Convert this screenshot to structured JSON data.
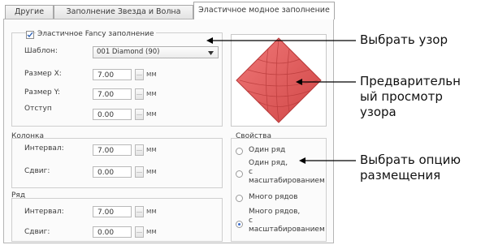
{
  "tabs": [
    "Другие",
    "Заполнение Звезда и Волна",
    "Эластичное модное заполнение"
  ],
  "fancy": {
    "checkbox_label": "Эластичное Fancy заполнение",
    "checked": true,
    "pattern_label": "Шаблон:",
    "pattern_value": "001 Diamond (90)",
    "size_x_label": "Размер X:",
    "size_x_value": "7.00",
    "size_y_label": "Размер Y:",
    "size_y_value": "7.00",
    "offset_label": "Отступ",
    "offset_value": "0.00",
    "unit": "мм"
  },
  "column": {
    "title": "Колонка",
    "interval_label": "Интервал:",
    "interval_value": "7.00",
    "shift_label": "Сдвиг:",
    "shift_value": "0.00"
  },
  "row": {
    "title": "Ряд",
    "interval_label": "Интервал:",
    "interval_value": "7.00",
    "shift_label": "Сдвиг:",
    "shift_value": "0.00"
  },
  "properties": {
    "title": "Свойства",
    "options": [
      {
        "line1": "Один ряд",
        "line2": "",
        "line3": "",
        "selected": false
      },
      {
        "line1": "Один ряд,",
        "line2": "с",
        "line3": "масштабированием",
        "selected": false
      },
      {
        "line1": "Много рядов",
        "line2": "",
        "line3": "",
        "selected": false
      },
      {
        "line1": "Много рядов,",
        "line2": "с",
        "line3": "масштабированием",
        "selected": true
      }
    ]
  },
  "callouts": {
    "select_pattern": "Выбрать узор",
    "preview_line1": "Предварительн",
    "preview_line2": "ый просмотр",
    "preview_line3": "узора",
    "layout_line1": "Выбрать опцию",
    "layout_line2": "размещения"
  },
  "colors": {
    "pattern_red": "#e35a5a",
    "pattern_dark": "#b83a3a"
  }
}
